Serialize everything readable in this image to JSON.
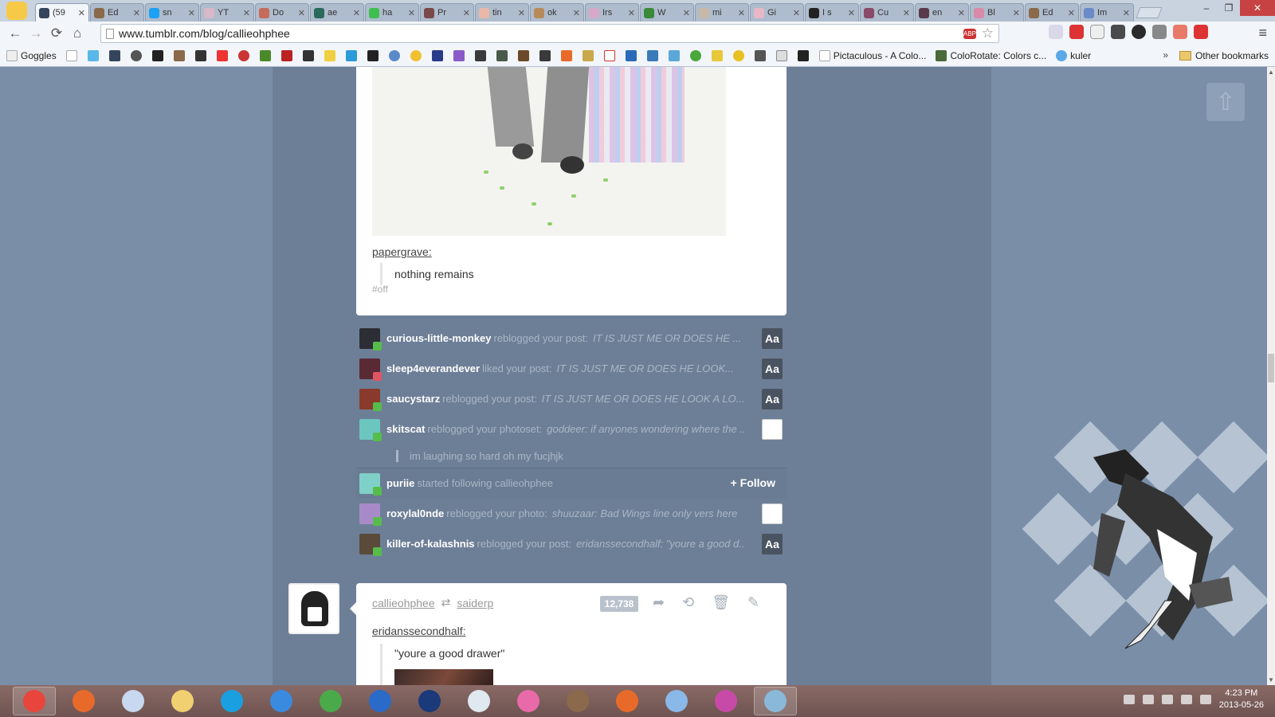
{
  "browser": {
    "tabs": [
      {
        "label": "(59",
        "color": "#35465c",
        "active": true
      },
      {
        "label": "Ed",
        "color": "#8a6a4a"
      },
      {
        "label": "sn",
        "color": "#1da1f2"
      },
      {
        "label": "YT",
        "color": "#d9b8c8"
      },
      {
        "label": "Do",
        "color": "#c66a5a"
      },
      {
        "label": "ae",
        "color": "#2a6a5a"
      },
      {
        "label": "ha",
        "color": "#3fbf4f"
      },
      {
        "label": "Pr",
        "color": "#7a4a4a"
      },
      {
        "label": "tin",
        "color": "#e9b8a8"
      },
      {
        "label": "ok",
        "color": "#b88a5a"
      },
      {
        "label": "Irs",
        "color": "#d8a8c8"
      },
      {
        "label": "W",
        "color": "#3a8a3a"
      },
      {
        "label": "mi",
        "color": "#c8b8a8"
      },
      {
        "label": "Gi",
        "color": "#e8b8c8"
      },
      {
        "label": "I s",
        "color": "#222222"
      },
      {
        "label": "Cu",
        "color": "#8a4a6a"
      },
      {
        "label": "en",
        "color": "#5a3a4a"
      },
      {
        "label": "Bl",
        "color": "#d88aa8"
      },
      {
        "label": "Ed",
        "color": "#8a6a4a"
      },
      {
        "label": "Im",
        "color": "#6a8ac8"
      }
    ],
    "close_glyph": "✕",
    "window_controls": {
      "minimize": "–",
      "maximize": "❐",
      "close": "✕"
    },
    "nav": {
      "back": "←",
      "forward": "→",
      "reload": "⟳",
      "home": "⌂"
    },
    "url": "www.tumblr.com/blog/callieohphee",
    "abp_label": "ABP",
    "star_glyph": "☆",
    "menu_glyph": "≡",
    "bookmarks": [
      {
        "label": "Goggles"
      },
      {
        "label": "Picta­culous - A Colo..."
      },
      {
        "label": "ColoRotate: Colors c..."
      },
      {
        "label": "kuler"
      }
    ],
    "bookmarks_overflow": "»",
    "other_bookmarks": "Other bookmarks"
  },
  "post1": {
    "source_user": "papergrave",
    "source_suffix": ":",
    "quote": "nothing remains",
    "tag": "#off"
  },
  "activity": [
    {
      "user": "curious-little-monkey",
      "action": "reblogged your post:",
      "snippet": "IT IS JUST ME OR DOES HE ...",
      "thumb": "Aa",
      "avatar_color": "#2d2d35",
      "badge_color": "#56bc4b"
    },
    {
      "user": "sleep4everandever",
      "action": "liked your post:",
      "snippet": "IT IS JUST ME OR DOES HE LOOK...",
      "thumb": "Aa",
      "avatar_color": "#5a2a34",
      "badge_color": "#e05563"
    },
    {
      "user": "saucystarz",
      "action": "reblogged your post:",
      "snippet": "IT IS JUST ME OR DOES HE LOOK A LO...",
      "thumb": "Aa",
      "avatar_color": "#8a3a2a",
      "badge_color": "#56bc4b"
    },
    {
      "user": "skitscat",
      "action": "reblogged your photoset:",
      "snippet": "goddeer: if anyones wondering where the ...",
      "thumb": "",
      "avatar_color": "#6cc6c0",
      "badge_color": "#56bc4b",
      "comment": "im laughing so hard oh my fucjhjk"
    },
    {
      "user": "puriie",
      "action": "started following callieohphee",
      "snippet": "",
      "follow": "+ Follow",
      "avatar_color": "#7fd0c8",
      "badge_color": "#56bc4b"
    },
    {
      "user": "roxylal0nde",
      "action": "reblogged your photo:",
      "snippet": "shuuzaar: Bad Wings line only vers here",
      "thumb": "",
      "avatar_color": "#a88ac8",
      "badge_color": "#56bc4b"
    },
    {
      "user": "killer-of-kalashnis",
      "action": "reblogged your post:",
      "snippet": "eridanssecondhalf: \"youre a good d...",
      "thumb": "Aa",
      "avatar_color": "#5a4a3a",
      "badge_color": "#56bc4b"
    }
  ],
  "post2": {
    "blog": "callieohphee",
    "reblog_glyph": "⇄",
    "reblogged_from": "saiderp",
    "notes": "12,738",
    "icons": {
      "share": "➦",
      "reblog": "⟲",
      "delete": "🗑",
      "edit": "✎"
    },
    "source_user": "eridanssecondhalf",
    "source_suffix": ":",
    "quote": "\"youre a good drawer\""
  },
  "to_top_glyph": "⇧",
  "taskbar": {
    "apps": [
      {
        "name": "chrome",
        "color": "#e8453c",
        "open": true
      },
      {
        "name": "firefox",
        "color": "#e86a2a"
      },
      {
        "name": "paint",
        "color": "#c8d8f0"
      },
      {
        "name": "explorer",
        "color": "#f0d070"
      },
      {
        "name": "skype",
        "color": "#1aa0e0"
      },
      {
        "name": "itunes",
        "color": "#3a8ae0"
      },
      {
        "name": "globe",
        "color": "#4aaa4a"
      },
      {
        "name": "pse",
        "color": "#2a6ac8"
      },
      {
        "name": "photoshop",
        "color": "#1a3a7a"
      },
      {
        "name": "notepad",
        "color": "#e0e8f0"
      },
      {
        "name": "osu",
        "color": "#e86aa8"
      },
      {
        "name": "fox",
        "color": "#8a6a4a"
      },
      {
        "name": "mushroom",
        "color": "#e86a2a"
      },
      {
        "name": "figure",
        "color": "#8ab8e8"
      },
      {
        "name": "colorpicker",
        "color": "#c84aa8"
      },
      {
        "name": "control",
        "color": "#8ab8d8",
        "open": true
      }
    ],
    "time": "4:23 PM",
    "date": "2013-05-26"
  }
}
